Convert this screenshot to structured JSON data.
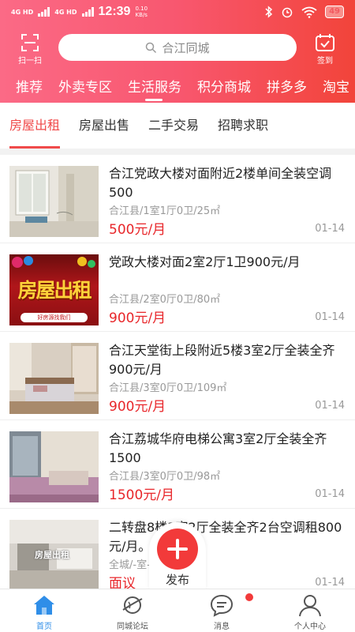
{
  "status_bar": {
    "signal1": "4G HD",
    "signal2": "4G HD",
    "time": "12:39",
    "speed_value": "0.10",
    "speed_unit": "KB/s",
    "battery": "49"
  },
  "topbar": {
    "scan_label": "扫一扫",
    "search_placeholder": "合江同城",
    "checkin_label": "签到"
  },
  "categories": [
    "推荐",
    "外卖专区",
    "生活服务",
    "积分商城",
    "拼多多",
    "淘宝"
  ],
  "active_category": "生活服务",
  "subtabs": [
    "房屋出租",
    "房屋出售",
    "二手交易",
    "招聘求职"
  ],
  "active_subtab": "房屋出租",
  "listings": [
    {
      "title": "合江党政大楼对面附近2楼单间全装空调500",
      "meta": "合江县/1室1厅0卫/25㎡",
      "price": "500元/月",
      "date": "01-14",
      "thumb": "bright-room-photo"
    },
    {
      "title": "党政大楼对面2室2厅1卫900元/月",
      "meta": "合江县/2室0厅0卫/80㎡",
      "price": "900元/月",
      "date": "01-14",
      "thumb": "rent-banner",
      "thumb_text": "房屋出租",
      "thumb_sub": "好房源找我们"
    },
    {
      "title": "合江天堂街上段附近5楼3室2厅全装全齐900元/月",
      "meta": "合江县/3室0厅0卫/109㎡",
      "price": "900元/月",
      "date": "01-14",
      "thumb": "bedroom-photo"
    },
    {
      "title": "合江荔城华府电梯公寓3室2厅全装全齐1500",
      "meta": "合江县/3室0厅0卫/98㎡",
      "price": "1500元/月",
      "date": "01-14",
      "thumb": "apartment-photo"
    },
    {
      "title": "二转盘8楼3室2厅全装全齐2台空调租800元/月。",
      "meta": "全城/-室-厅-卫/-㎡",
      "price": "面议",
      "date": "01-14",
      "thumb": "living-room-photo",
      "thumb_text": "房屋出租"
    }
  ],
  "fab": {
    "label": "发布"
  },
  "bottom_nav": [
    {
      "label": "首页",
      "icon": "home-icon"
    },
    {
      "label": "同城论坛",
      "icon": "planet-icon"
    },
    {
      "label": "消息",
      "icon": "message-icon"
    },
    {
      "label": "个人中心",
      "icon": "person-icon"
    }
  ],
  "colors": {
    "accent": "#f04a4a",
    "header_start": "#fb6a86",
    "header_end": "#f2443a",
    "nav_active": "#2f8ee8"
  }
}
